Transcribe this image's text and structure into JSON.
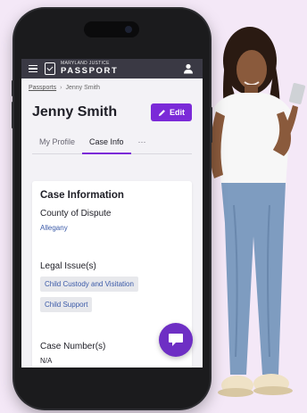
{
  "app": {
    "logo_sub": "MARYLAND JUSTICE",
    "logo_main": "PASSPORT"
  },
  "breadcrumb": {
    "root": "Passports",
    "current": "Jenny Smith"
  },
  "page": {
    "title": "Jenny Smith",
    "edit_label": "Edit"
  },
  "tabs": [
    {
      "label": "My Profile",
      "active": false
    },
    {
      "label": "Case Info",
      "active": true
    },
    {
      "label": "···",
      "active": false
    }
  ],
  "case": {
    "heading": "Case Information",
    "county_label": "County of Dispute",
    "county_value": "Allegany",
    "legal_label": "Legal Issue(s)",
    "legal_issues": [
      "Child Custody and Visitation",
      "Child Support"
    ],
    "case_number_label": "Case Number(s)",
    "case_number_value": "N/A"
  },
  "colors": {
    "accent": "#7b2ad8",
    "appbar": "#3a3944",
    "link": "#3b5aa8",
    "background": "#f4e8f7"
  },
  "icons": [
    "hamburger-menu-icon",
    "passport-logo-icon",
    "user-account-icon",
    "pencil-icon",
    "chat-icon"
  ]
}
